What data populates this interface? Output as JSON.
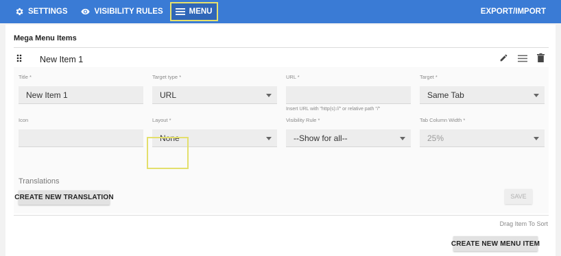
{
  "topbar": {
    "settings_label": "SETTINGS",
    "visibility_label": "VISIBILITY RULES",
    "menu_label": "MENU",
    "export_label": "EXPORT/IMPORT",
    "bg_color": "#3a7bd5",
    "highlight_color": "#e8e26a"
  },
  "main": {
    "title": "Mega Menu Items",
    "item": {
      "name": "New Item 1",
      "actions": [
        "pencil-icon",
        "menu-lines-icon",
        "trash-icon"
      ]
    },
    "fields": {
      "title": {
        "label": "Title *",
        "value": "New Item 1"
      },
      "target_type": {
        "label": "Target type *",
        "value": "URL"
      },
      "url": {
        "label": "URL *",
        "value": "",
        "hint": "Insert URL with \"http(s)://\" or relative path \"/\""
      },
      "target": {
        "label": "Target *",
        "value": "Same Tab"
      },
      "icon": {
        "label": "Icon",
        "value": ""
      },
      "layout": {
        "label": "Layout *",
        "value": "None"
      },
      "visibility_rule": {
        "label": "Visibility Rule *",
        "value": "--Show for all--"
      },
      "tab_column_width": {
        "label": "Tab Column Width *",
        "value": "25%"
      }
    },
    "translations_label": "Translations",
    "create_translation_label": "CREATE NEW TRANSLATION",
    "save_label": "SAVE",
    "drag_sort_label": "Drag Item To Sort",
    "create_menu_item_label": "CREATE NEW MENU ITEM"
  }
}
